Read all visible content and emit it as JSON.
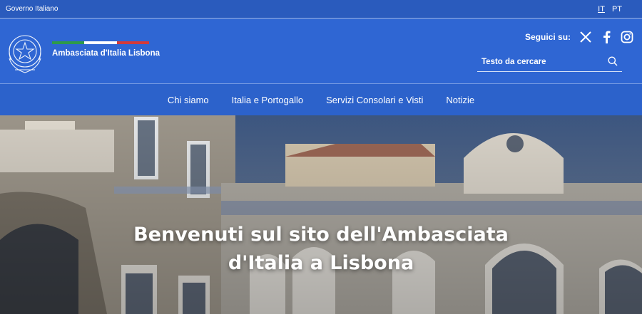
{
  "topbar": {
    "gov_label": "Governo Italiano",
    "languages": [
      {
        "code": "IT",
        "active": true
      },
      {
        "code": "PT",
        "active": false
      }
    ]
  },
  "header": {
    "site_title": "Ambasciata d'Italia Lisbona",
    "flag_colors": [
      "#2e9a4a",
      "#ffffff",
      "#d33a3a"
    ],
    "follow_label": "Seguici su:",
    "social_icons": [
      "x-icon",
      "facebook-icon",
      "instagram-icon"
    ],
    "search": {
      "placeholder": "Testo da cercare",
      "icon": "search-icon"
    }
  },
  "nav": {
    "items": [
      {
        "label": "Chi siamo"
      },
      {
        "label": "Italia e Portogallo"
      },
      {
        "label": "Servizi Consolari e Visti"
      },
      {
        "label": "Notizie"
      }
    ]
  },
  "hero": {
    "title_line1": "Benvenuti sul sito dell'Ambasciata",
    "title_line2": "d'Italia a Lisbona"
  },
  "colors": {
    "topbar_bg": "#2a5bbd",
    "header_bg": "#2f66d3",
    "nav_bg": "#2c62cb"
  }
}
